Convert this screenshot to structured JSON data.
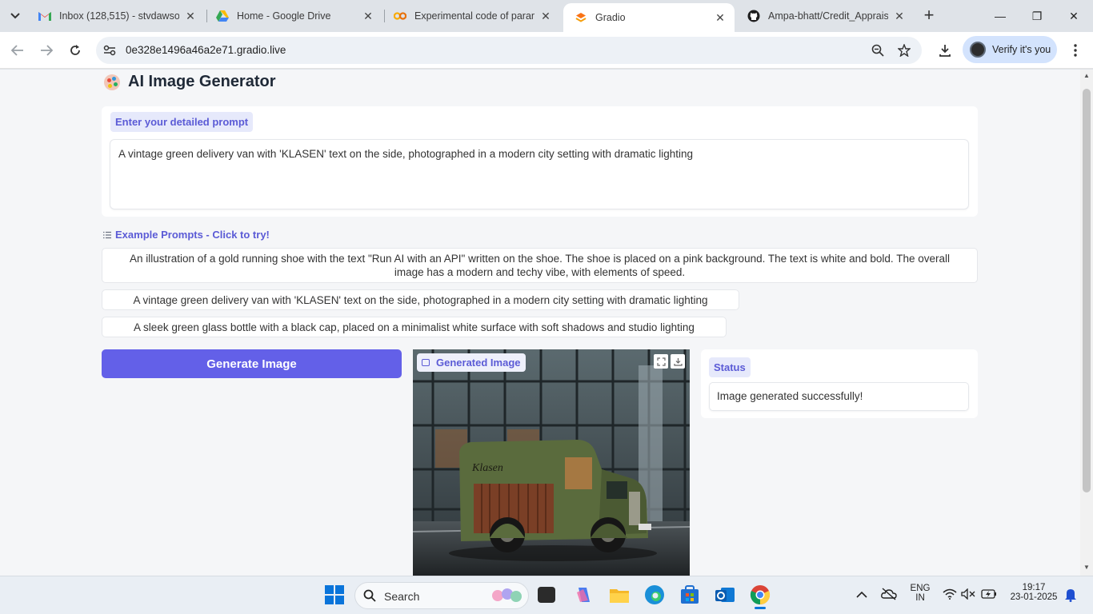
{
  "browser": {
    "tabs": [
      {
        "title": "Inbox (128,515) - stvdawson...",
        "favicon": "gmail-icon",
        "active": false
      },
      {
        "title": "Home - Google Drive",
        "favicon": "drive-icon",
        "active": false
      },
      {
        "title": "Experimental code of param...",
        "favicon": "colab-icon",
        "active": false
      },
      {
        "title": "Gradio",
        "favicon": "gradio-icon",
        "active": true
      },
      {
        "title": "Ampa-bhatt/Credit_Apprais...",
        "favicon": "github-icon",
        "active": false
      }
    ],
    "url": "0e328e1496a46a2e71.gradio.live",
    "verify_label": "Verify it's you"
  },
  "app": {
    "title": "AI Image Generator",
    "prompt_label": "Enter your detailed prompt",
    "prompt_value": "A vintage green delivery van with 'KLASEN' text on the side, photographed in a modern city setting with dramatic lighting",
    "examples_label": "Example Prompts - Click to try!",
    "examples": [
      "An illustration of a gold running shoe with the text \"Run AI with an API\" written on the shoe. The shoe is placed on a pink background. The text is white and bold. The overall image has a modern and techy vibe, with elements of speed.",
      "A vintage green delivery van with 'KLASEN' text on the side, photographed in a modern city setting with dramatic lighting",
      "A sleek green glass bottle with a black cap, placed on a minimalist white surface with soft shadows and studio lighting"
    ],
    "generate_label": "Generate Image",
    "image_label": "Generated Image",
    "image_van_text": "Klasen",
    "status_label": "Status",
    "status_value": "Image generated successfully!"
  },
  "taskbar": {
    "search_label": "Search",
    "lang_top": "ENG",
    "lang_bottom": "IN",
    "time": "19:17",
    "date": "23-01-2025"
  },
  "colors": {
    "accent": "#6360e8",
    "label_text": "#5b5bd6",
    "label_bg": "#e6e9fb",
    "page_bg": "#f5f6f8"
  }
}
